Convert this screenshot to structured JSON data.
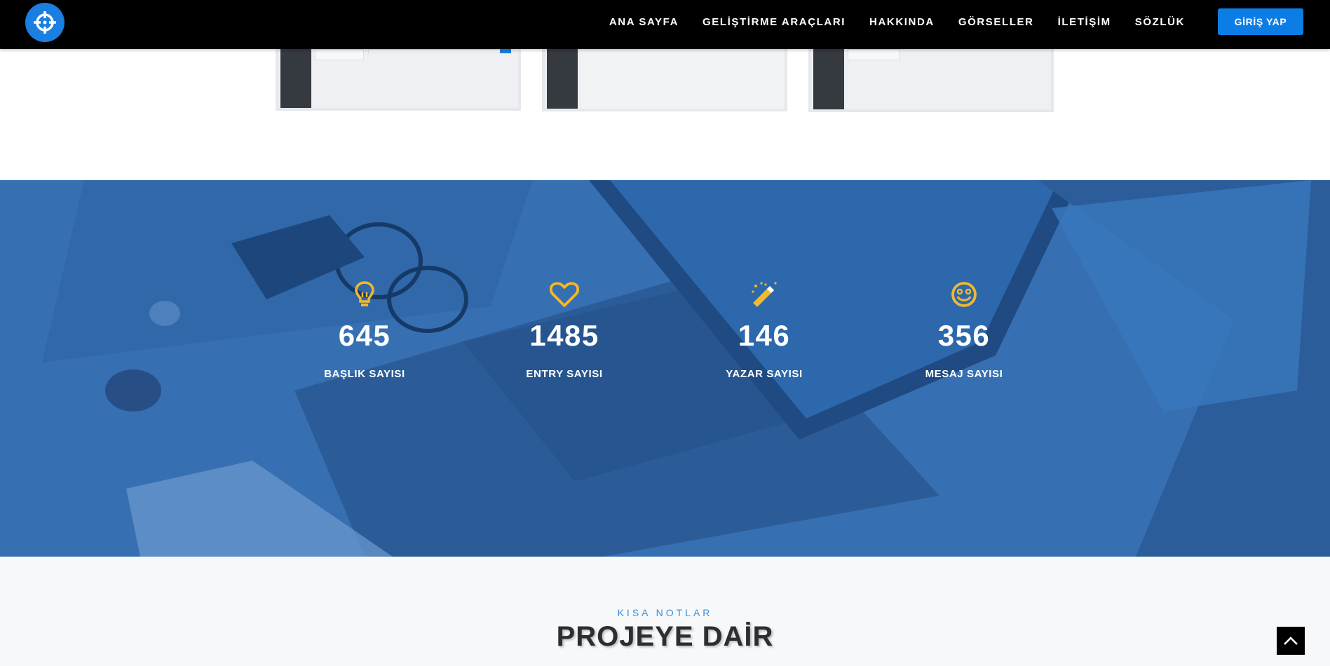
{
  "nav": {
    "items": [
      {
        "label": "ANA SAYFA"
      },
      {
        "label": "GELİŞTİRME ARAÇLARI"
      },
      {
        "label": "HAKKINDA"
      },
      {
        "label": "GÖRSELLER"
      },
      {
        "label": "İLETİŞİM"
      },
      {
        "label": "SÖZLÜK"
      }
    ],
    "login_label": "GİRİŞ YAP",
    "logo_icon": "crosshair-icon"
  },
  "colors": {
    "accent": "#0d7de6",
    "stat_icon": "#f2b82e",
    "overlay_blue": "#3b77ba"
  },
  "stats": [
    {
      "icon": "lightbulb-icon",
      "value": "645",
      "label": "BAŞLIK SAYISI"
    },
    {
      "icon": "heart-icon",
      "value": "1485",
      "label": "ENTRY SAYISI"
    },
    {
      "icon": "magic-wand-icon",
      "value": "146",
      "label": "YAZAR SAYISI"
    },
    {
      "icon": "smile-icon",
      "value": "356",
      "label": "MESAJ SAYISI"
    }
  ],
  "notes": {
    "subtitle": "KISA NOTLAR",
    "title": "PROJEYE DAİR"
  }
}
